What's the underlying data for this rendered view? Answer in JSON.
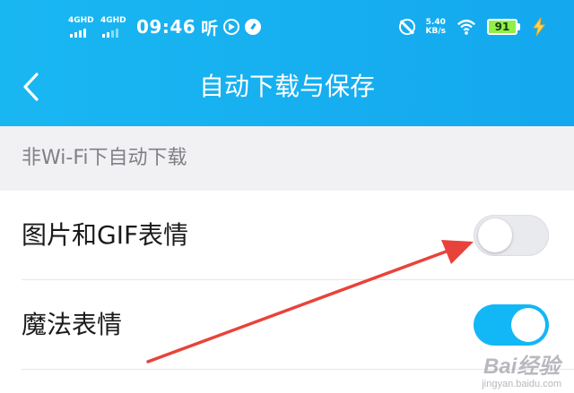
{
  "status_bar": {
    "network_1": "4GHD",
    "network_2": "4GHD",
    "time": "09:46",
    "app_glyph": "听",
    "net_speed": "5.40",
    "net_speed_unit": "KB/s",
    "battery": "91",
    "icons": [
      "signal-icon",
      "play-icon",
      "gauge-icon",
      "alarm-icon",
      "wifi-icon",
      "battery-icon",
      "charging-bolt-icon"
    ]
  },
  "header": {
    "title": "自动下载与保存",
    "back_icon": "chevron-left-icon"
  },
  "section": {
    "title": "非Wi-Fi下自动下载"
  },
  "settings": [
    {
      "label": "图片和GIF表情",
      "enabled": false
    },
    {
      "label": "魔法表情",
      "enabled": true
    }
  ],
  "colors": {
    "header": "#14a8ee",
    "toggle_on": "#12b7f5",
    "toggle_off": "#e9eaee",
    "annotation_arrow": "#e8433b"
  },
  "watermark": {
    "logo": "Bai经验",
    "url": "jingyan.baidu.com"
  }
}
